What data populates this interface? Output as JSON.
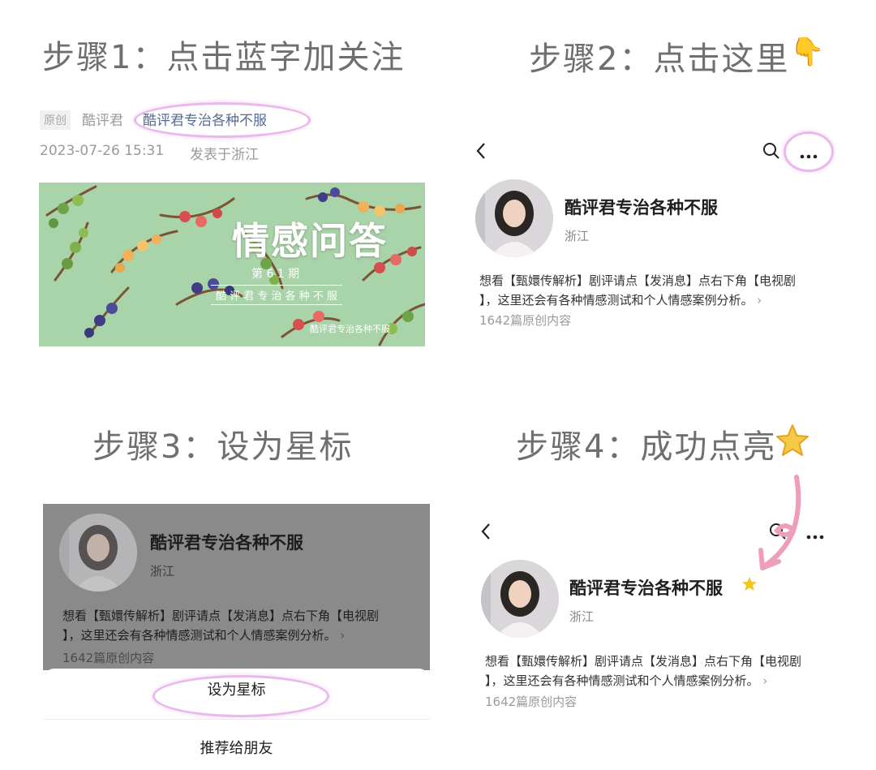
{
  "steps": {
    "step1": "步骤1：点击蓝字加关注",
    "step2": "步骤2：点击这里",
    "step3": "步骤3：设为星标",
    "step4": "步骤4：成功点亮"
  },
  "article": {
    "original_tag": "原创",
    "author": "酷评君",
    "account_link": "酷评君专治各种不服",
    "date": "2023-07-26 15:31",
    "published_in": "发表于浙江"
  },
  "banner": {
    "title": "情感问答",
    "issue": "第 6 1 期",
    "account_spaced": "酷 评 君 专 治 各 种 不 服",
    "watermark": "酷评君专治各种不服",
    "bg_color": "#a9d3a8"
  },
  "profile": {
    "name": "酷评君专治各种不服",
    "location": "浙江",
    "desc_line1": "想看【甄嬛传解析】剧评请点【发消息】点右下角【电视剧",
    "desc_line2": "】，这里还会有各种情感测试和个人情感案例分析。",
    "count": "1642篇原创内容"
  },
  "sheet": {
    "star_action": "设为星标",
    "recommend_action": "推荐给朋友"
  },
  "colors": {
    "highlight": "#e9b9ec",
    "star": "#f5c518",
    "arrow": "#ee9dbb"
  }
}
